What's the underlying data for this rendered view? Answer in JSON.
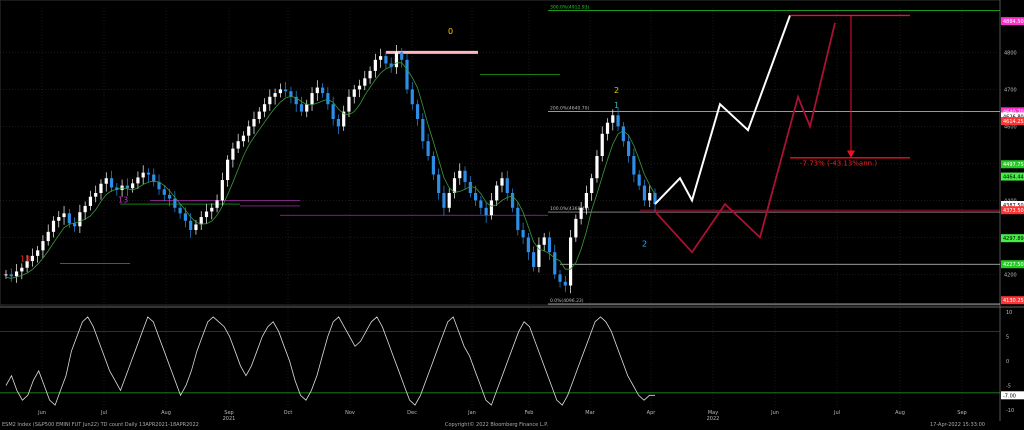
{
  "chart_data": [
    {
      "type": "candlestick",
      "xlabel": "",
      "ylabel": "",
      "ylim": [
        4120,
        4920
      ],
      "months": [
        "Jun",
        "Jul",
        "Aug",
        "Sep",
        "Oct",
        "Nov",
        "Dec",
        "Jan",
        "Feb",
        "Mar",
        "Apr",
        "May",
        "Jun",
        "Jul",
        "Aug",
        "Sep"
      ],
      "years": [
        "2021",
        "2022"
      ],
      "y_ticks": [
        4200,
        4300,
        4400,
        4500,
        4600,
        4700,
        4800
      ],
      "fib_labels": [
        "300.0%(4912.93)",
        "200.0%(4640.70)",
        "100.0%(4368.46)",
        "0.0%(4096.23)"
      ],
      "price_tags": [
        {
          "text": "4884.50",
          "value": 4884.5,
          "color": "#ff33cc"
        },
        {
          "text": "4640.70",
          "value": 4640.7,
          "color": "#ff33cc"
        },
        {
          "text": "4626.80",
          "value": 4626.8,
          "color": "#ffffff"
        },
        {
          "text": "4614.25",
          "value": 4614.25,
          "color": "#ff3333"
        },
        {
          "text": "4497.75",
          "value": 4497.75,
          "color": "#22cc22"
        },
        {
          "text": "4464.44",
          "value": 4464.44,
          "color": "#44ee44"
        },
        {
          "text": "4387.50",
          "value": 4387.5,
          "color": "#ffffff"
        },
        {
          "text": "4373.50",
          "value": 4373.5,
          "color": "#ff3333"
        },
        {
          "text": "4297.89",
          "value": 4297.89,
          "color": "#44ee44"
        },
        {
          "text": "4227.50",
          "value": 4227.5,
          "color": "#22cc22"
        },
        {
          "text": "4130.25",
          "value": 4130.25,
          "color": "#ff3333"
        }
      ],
      "annotations": {
        "projection_label": "-7.73% (-43.13%ann.)",
        "count_13_a": "13",
        "count_13_b": "13",
        "count_0": "0",
        "count_2_top": "2",
        "count_1": "1",
        "count_2_bottom": "2"
      },
      "series": [
        {
          "values": [
            4200,
            4195,
            4208,
            4218,
            4236,
            4250,
            4265,
            4290,
            4315,
            4345,
            4355,
            4365,
            4338,
            4330,
            4368,
            4385,
            4410,
            4420,
            4445,
            4460,
            4435,
            4428,
            4440,
            4433,
            4446,
            4462,
            4475,
            4470,
            4450,
            4430,
            4415,
            4405,
            4380,
            4365,
            4345,
            4320,
            4335,
            4355,
            4370,
            4380,
            4400,
            4455,
            4510,
            4540,
            4560,
            4575,
            4600,
            4620,
            4640,
            4660,
            4680,
            4690,
            4700,
            4695,
            4680,
            4660,
            4640,
            4660,
            4690,
            4705,
            4690,
            4660,
            4620,
            4600,
            4640,
            4680,
            4700,
            4710,
            4730,
            4750,
            4780,
            4790,
            4770,
            4760,
            4800,
            4780,
            4700,
            4660,
            4620,
            4560,
            4520,
            4470,
            4420,
            4380,
            4420,
            4460,
            4480,
            4450,
            4420,
            4400,
            4380,
            4360,
            4400,
            4440,
            4460,
            4420,
            4380,
            4320,
            4300,
            4260,
            4220,
            4280,
            4300,
            4260,
            4200,
            4180,
            4170,
            4300,
            4350,
            4380,
            4420,
            4460,
            4520,
            4580,
            4610,
            4630,
            4600,
            4560,
            4520,
            4470,
            4440,
            4400,
            4420,
            4390
          ]
        }
      ],
      "projections": [
        {
          "name": "white",
          "values": [
            4390,
            4460,
            4400,
            4660,
            4590,
            4900
          ]
        },
        {
          "name": "red",
          "values": [
            4370,
            4260,
            4390,
            4300,
            4680,
            4600,
            4880
          ]
        }
      ]
    },
    {
      "type": "line",
      "ylim": [
        -10,
        10
      ],
      "y_ticks": [
        -10,
        -5,
        0,
        5,
        10
      ],
      "last_value_label": "-7.00",
      "levels": [
        6,
        -6.5
      ],
      "values": [
        -5,
        -3,
        -6,
        -8,
        -7,
        -4,
        -2,
        -5,
        -8,
        -9,
        -6,
        -3,
        2,
        5,
        8,
        9,
        7,
        4,
        1,
        -2,
        -4,
        -6,
        -3,
        0,
        3,
        6,
        9,
        8,
        5,
        2,
        -1,
        -4,
        -7,
        -5,
        -2,
        2,
        5,
        8,
        9,
        8,
        7,
        5,
        2,
        -1,
        -3,
        -1,
        2,
        5,
        7,
        8,
        6,
        3,
        0,
        -4,
        -7,
        -8,
        -6,
        -3,
        1,
        5,
        8,
        9,
        7,
        5,
        3,
        4,
        6,
        8,
        9,
        7,
        4,
        1,
        -2,
        -5,
        -8,
        -9,
        -7,
        -4,
        -1,
        2,
        5,
        8,
        9,
        6,
        3,
        1,
        -2,
        -5,
        -8,
        -9,
        -6,
        -3,
        0,
        3,
        6,
        8,
        7,
        4,
        1,
        -2,
        -5,
        -8,
        -9,
        -7,
        -4,
        -1,
        2,
        5,
        8,
        9,
        8,
        6,
        3,
        0,
        -3,
        -5,
        -7,
        -8,
        -7,
        -7
      ]
    }
  ],
  "footer": {
    "left": "ESM2 Index (S&P500 EMINI FUT  Jun22) TD count  Daily 13APR2021-18APR2022",
    "center": "Copyright© 2022 Bloomberg Finance L.P.",
    "right": "17-Apr-2022 15:33:00"
  },
  "colors": {
    "bg": "#000000",
    "grid": "#2a2a2a",
    "candle_up": "#ffffff",
    "candle_down": "#2d8ee8",
    "fib": "#cccccc",
    "osc": "#dddddd",
    "red": "#cc1122",
    "green": "#22cc22",
    "magenta": "#cc33cc"
  }
}
